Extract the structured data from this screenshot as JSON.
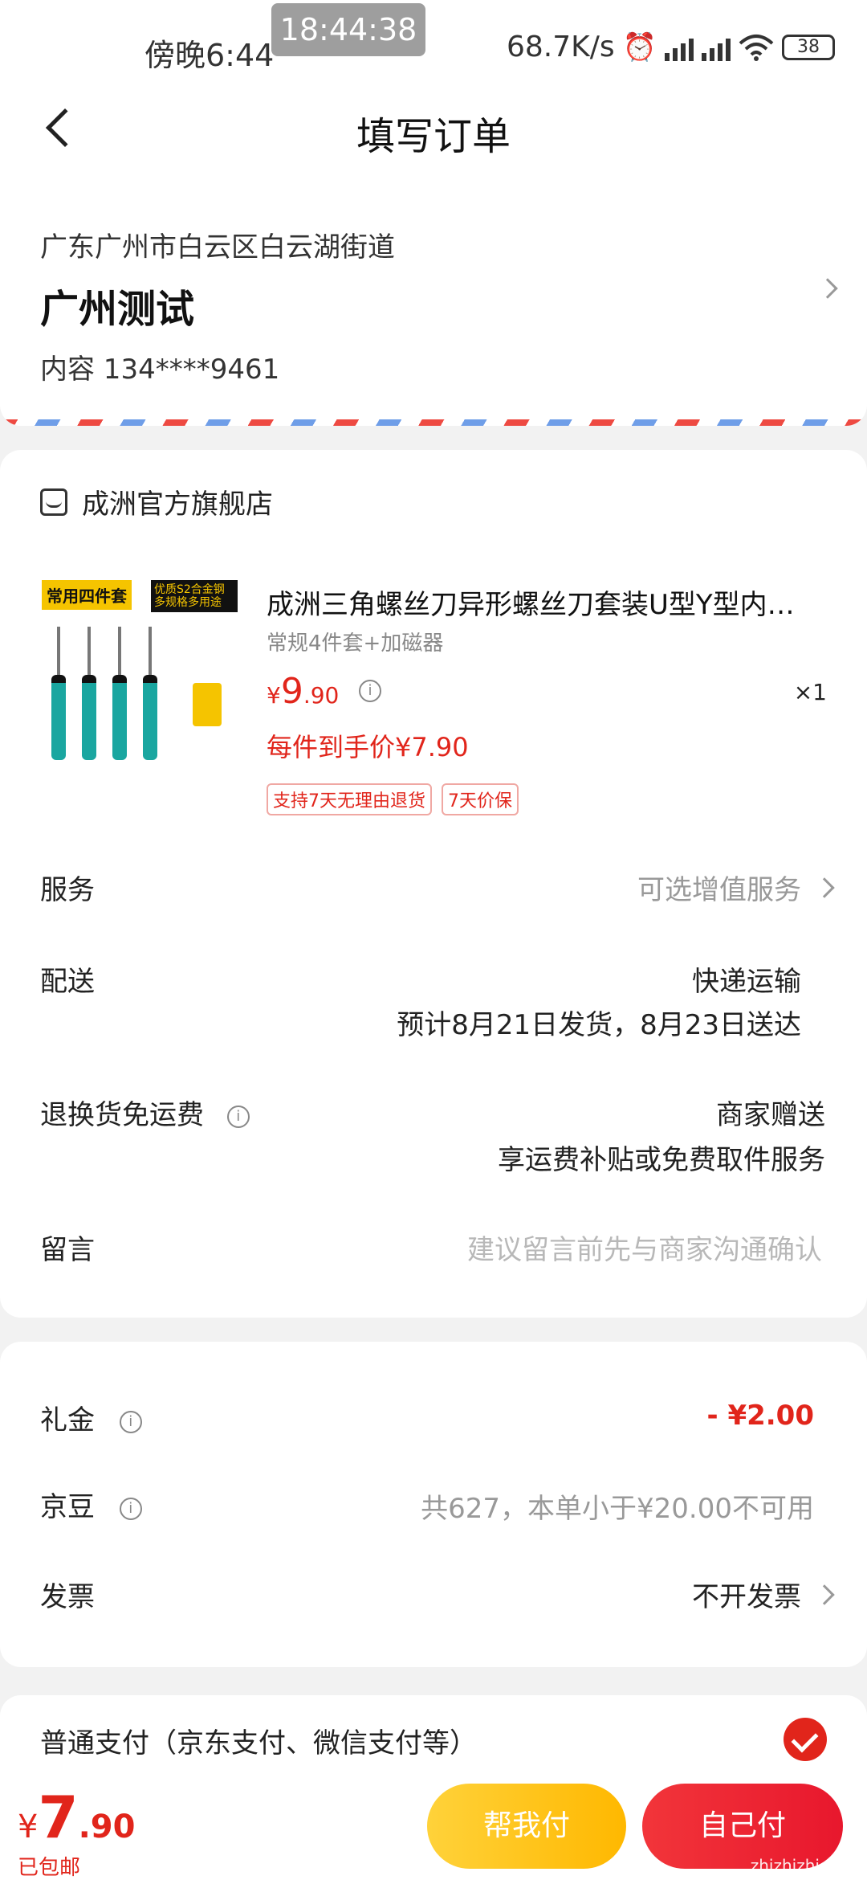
{
  "status_bar": {
    "time": "傍晚6:44",
    "clock": "18:44:38",
    "net_speed": "68.7K/s",
    "battery": "38"
  },
  "header": {
    "title": "填写订单"
  },
  "address": {
    "line": "广东广州市白云区白云湖街道",
    "name": "广州测试",
    "contact": "内容  134****9461"
  },
  "order": {
    "shop_name": "成洲官方旗舰店",
    "product": {
      "image_tag_left": "常用四件套",
      "image_tag_right": "优质S2合金钢 多规格多用途",
      "title": "成洲三角螺丝刀异形螺丝刀套装U型Y型内…",
      "spec": "常规4件套+加磁器",
      "price_symbol": "¥",
      "price_int": "9",
      "price_dec": ".90",
      "quantity": "×1",
      "unit_price": "每件到手价¥7.90",
      "badges": [
        "支持7天无理由退货",
        "7天价保"
      ]
    },
    "service": {
      "label": "服务",
      "value": "可选增值服务"
    },
    "delivery": {
      "label": "配送",
      "method": "快递运输",
      "eta": "预计8月21日发货，8月23日送达"
    },
    "return_shipping": {
      "label": "退换货免运费",
      "line1": "商家赠送",
      "line2": "享运费补贴或免费取件服务"
    },
    "message": {
      "label": "留言",
      "placeholder": "建议留言前先与商家沟通确认"
    }
  },
  "bonus": {
    "gift": {
      "label": "礼金",
      "value": "- ¥2.00"
    },
    "beans": {
      "label": "京豆",
      "value": "共627，本单小于¥20.00不可用"
    },
    "invoice": {
      "label": "发票",
      "value": "不开发票"
    }
  },
  "payment": {
    "label": "普通支付（京东支付、微信支付等）"
  },
  "bottom": {
    "currency": "¥",
    "total_int": "7",
    "total_dec": ".90",
    "shipping_note": "已包邮",
    "help_pay": "帮我付",
    "self_pay": "自己付",
    "watermark": "zhizhizhi.com"
  },
  "colors": {
    "accent": "#e1251b",
    "help_button": "#ffc21a",
    "background": "#f2f2f2"
  }
}
